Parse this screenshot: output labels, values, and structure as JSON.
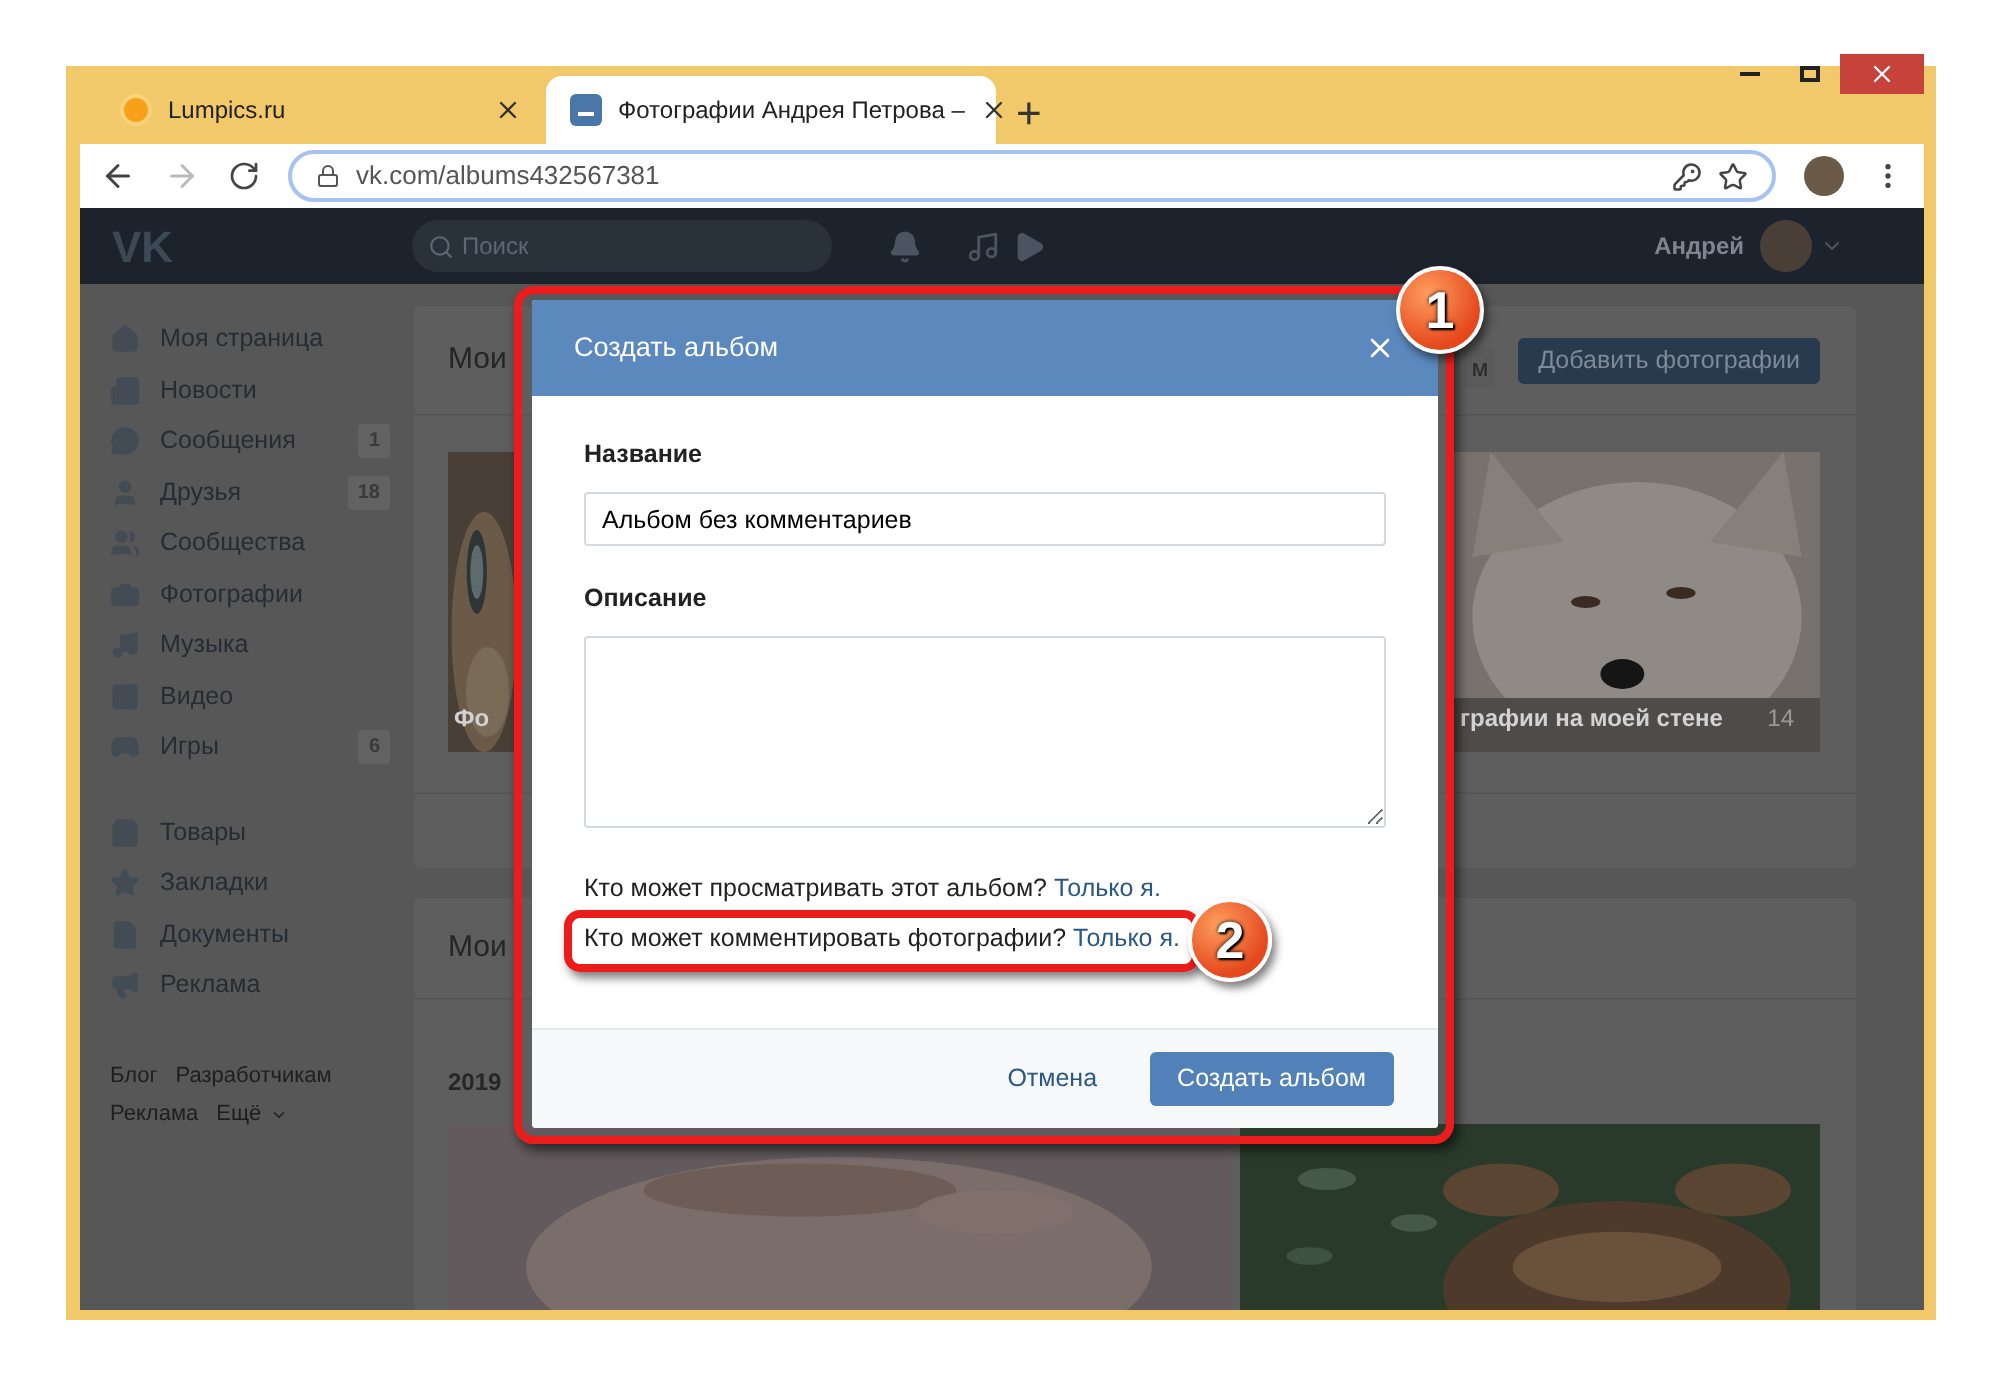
{
  "browser": {
    "tabs": [
      {
        "title": "Lumpics.ru",
        "selected": false
      },
      {
        "title": "Фотографии Андрея Петрова –",
        "selected": true
      }
    ],
    "new_tab": "+",
    "address": "vk.com/albums432567381"
  },
  "vk_header": {
    "logo": "VK",
    "search_placeholder": "Поиск",
    "user_name": "Андрей"
  },
  "sidebar": {
    "groups": [
      {
        "items": [
          {
            "label": "Моя страница"
          },
          {
            "label": "Новости"
          },
          {
            "label": "Сообщения",
            "count": "1"
          },
          {
            "label": "Друзья",
            "count": "18"
          },
          {
            "label": "Сообщества"
          },
          {
            "label": "Фотографии"
          },
          {
            "label": "Музыка"
          },
          {
            "label": "Видео"
          },
          {
            "label": "Игры",
            "count": "6"
          }
        ]
      },
      {
        "items": [
          {
            "label": "Товары"
          },
          {
            "label": "Закладки"
          },
          {
            "label": "Документы"
          },
          {
            "label": "Реклама"
          }
        ]
      }
    ],
    "footer_rows": [
      [
        "Блог",
        "Разработчикам"
      ],
      [
        "Реклама",
        "Ещё"
      ]
    ]
  },
  "albums_card": {
    "title": "Мои",
    "action_fragment": "м",
    "add_button": "Добавить фотографии",
    "albums": [
      {
        "caption": "Фо"
      },
      {
        "caption": "графии на моей стене",
        "count": "14"
      }
    ]
  },
  "photos_card": {
    "title": "Мои",
    "date": "2019"
  },
  "dialog": {
    "title": "Создать альбом",
    "fields": [
      {
        "label": "Название",
        "kind": "input",
        "value": "Альбом без комментариев"
      },
      {
        "label": "Описание",
        "kind": "textarea"
      }
    ],
    "privacy": [
      {
        "question": "Кто может просматривать этот альбом?",
        "value": "Только я."
      },
      {
        "question": "Кто может комментировать фотографии?",
        "value": "Только я."
      }
    ],
    "cancel": "Отмена",
    "submit": "Создать альбом"
  },
  "annotations": [
    {
      "label": "1"
    },
    {
      "label": "2"
    }
  ]
}
